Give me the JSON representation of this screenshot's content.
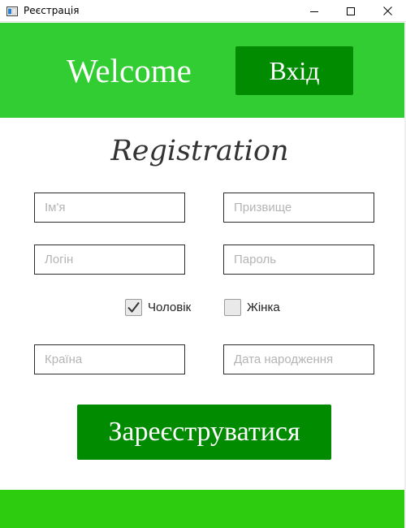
{
  "window": {
    "title": "Реєстрація",
    "icon": "app-window-icon",
    "controls": [
      "minimize-icon",
      "maximize-icon",
      "close-icon"
    ]
  },
  "header": {
    "welcome": "Welcome",
    "login_label": "Вхід"
  },
  "form": {
    "title": "Registration",
    "first_name": {
      "placeholder": "Ім'я",
      "value": ""
    },
    "last_name": {
      "placeholder": "Призвище",
      "value": ""
    },
    "login": {
      "placeholder": "Логін",
      "value": ""
    },
    "password": {
      "placeholder": "Пароль",
      "value": ""
    },
    "gender": {
      "male": {
        "label": "Чоловік",
        "checked": true
      },
      "female": {
        "label": "Жінка",
        "checked": false
      }
    },
    "country": {
      "placeholder": "Країна",
      "value": ""
    },
    "birth_date": {
      "placeholder": "Дата народження",
      "value": ""
    },
    "register_label": "Зареєструватися"
  },
  "colors": {
    "header_green": "#32cd32",
    "button_green": "#008b00",
    "footer_green": "#2ecc0e"
  }
}
